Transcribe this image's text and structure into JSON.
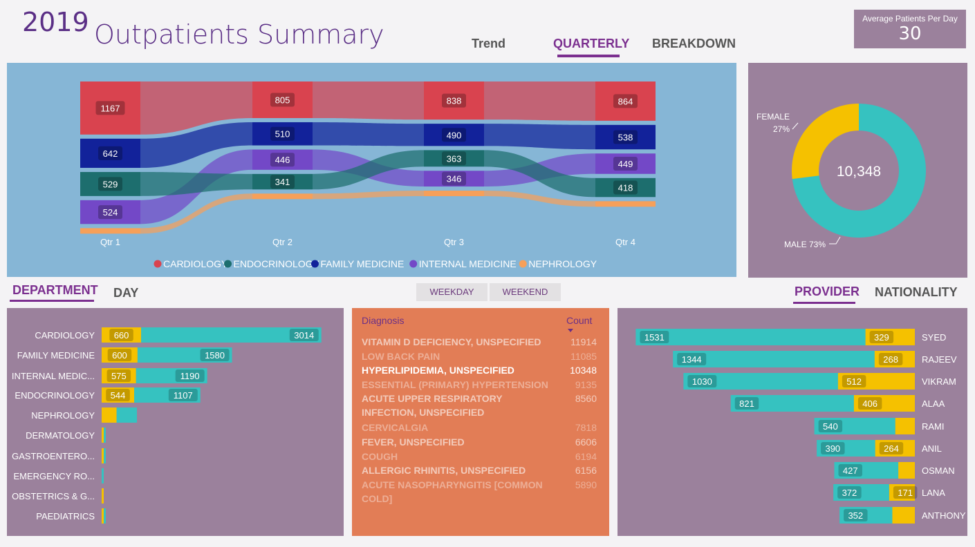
{
  "header": {
    "year": "2019",
    "title": "Outpatients Summary",
    "tabs": [
      {
        "label": "Trend",
        "active": false
      },
      {
        "label": "QUARTERLY",
        "active": true
      },
      {
        "label": "BREAKDOWN",
        "active": false
      }
    ]
  },
  "kpi": {
    "label": "Average Patients Per Day",
    "value": "30"
  },
  "chart_data": [
    {
      "type": "ribbon",
      "categories": [
        "Qtr 1",
        "Qtr 2",
        "Qtr 3",
        "Qtr 4"
      ],
      "series": [
        {
          "name": "CARDIOLOGY",
          "color": "#d9434f",
          "values": [
            1167,
            805,
            838,
            864
          ]
        },
        {
          "name": "ENDOCRINOLOGY",
          "color": "#1d6e6e",
          "values": [
            529,
            341,
            363,
            418
          ]
        },
        {
          "name": "FAMILY MEDICINE",
          "color": "#12229a",
          "values": [
            642,
            510,
            490,
            538
          ]
        },
        {
          "name": "INTERNAL MEDICINE",
          "color": "#7348c7",
          "values": [
            524,
            446,
            346,
            449
          ]
        },
        {
          "name": "NEPHROLOGY",
          "color": "#f6a05a",
          "values": [
            null,
            null,
            null,
            null
          ]
        }
      ],
      "legend_position": "bottom"
    },
    {
      "type": "pie",
      "center_label": "10,348",
      "slices": [
        {
          "label": "FEMALE",
          "pct_label": "27%",
          "value": 27,
          "color": "#f5c100"
        },
        {
          "label": "MALE",
          "pct_label": "73%",
          "value": 73,
          "color": "#36c2c0"
        }
      ]
    },
    {
      "type": "bar",
      "orientation": "horizontal",
      "categories": [
        "CARDIOLOGY",
        "FAMILY MEDICINE",
        "INTERNAL MEDIC...",
        "ENDOCRINOLOGY",
        "NEPHROLOGY",
        "DERMATOLOGY",
        "GASTROENTERO...",
        "EMERGENCY RO...",
        "OBSTETRICS & G...",
        "PAEDIATRICS"
      ],
      "series": [
        {
          "color": "#f5c100",
          "values": [
            660,
            600,
            575,
            544,
            250,
            35,
            8,
            0,
            30,
            5
          ],
          "labels": [
            "660",
            "600",
            "575",
            "544",
            "",
            "",
            "",
            "",
            "",
            ""
          ]
        },
        {
          "color": "#36c2c0",
          "values": [
            3014,
            1580,
            1190,
            1107,
            340,
            15,
            25,
            20,
            0,
            5
          ],
          "labels": [
            "3014",
            "1580",
            "1190",
            "1107",
            "",
            "",
            "",
            "",
            "",
            ""
          ]
        }
      ],
      "xlim": [
        0,
        3700
      ]
    },
    {
      "type": "bar",
      "orientation": "horizontal",
      "categories": [
        "SYED",
        "RAJEEV",
        "VIKRAM",
        "ALAA",
        "RAMI",
        "ANIL",
        "OSMAN",
        "LANA",
        "ANTHONY"
      ],
      "series": [
        {
          "color": "#36c2c0",
          "values": [
            1531,
            1344,
            1030,
            821,
            540,
            390,
            427,
            372,
            352
          ],
          "labels": [
            "1531",
            "1344",
            "1030",
            "821",
            "540",
            "390",
            "427",
            "372",
            "352"
          ]
        },
        {
          "color": "#f5c100",
          "values": [
            329,
            268,
            512,
            406,
            130,
            264,
            110,
            171,
            150
          ],
          "labels": [
            "329",
            "268",
            "512",
            "406",
            "",
            "264",
            "",
            "171",
            ""
          ]
        }
      ],
      "xlim": [
        0,
        2000
      ]
    }
  ],
  "ribbon_legend": [
    {
      "label": "CARDIOLOGY",
      "color": "#d9434f"
    },
    {
      "label": "ENDOCRINOLOGY",
      "color": "#1d6e6e"
    },
    {
      "label": "FAMILY MEDICINE",
      "color": "#12229a"
    },
    {
      "label": "INTERNAL MEDICINE",
      "color": "#7348c7"
    },
    {
      "label": "NEPHROLOGY",
      "color": "#f6a05a"
    }
  ],
  "dept_tabs": [
    {
      "label": "DEPARTMENT",
      "active": true
    },
    {
      "label": "DAY",
      "active": false
    }
  ],
  "day_buttons": [
    "WEEKDAY",
    "WEEKEND"
  ],
  "diagnosis": {
    "col_name": "Diagnosis",
    "col_count": "Count",
    "rows": [
      {
        "name": "VITAMIN D DEFICIENCY, UNSPECIFIED",
        "count": "11914",
        "style": "mid"
      },
      {
        "name": "LOW BACK PAIN",
        "count": "11085",
        "style": "dim"
      },
      {
        "name": "HYPERLIPIDEMIA, UNSPECIFIED",
        "count": "10348",
        "style": "hl"
      },
      {
        "name": "ESSENTIAL (PRIMARY) HYPERTENSION",
        "count": "9135",
        "style": "dim"
      },
      {
        "name": "ACUTE UPPER RESPIRATORY INFECTION, UNSPECIFIED",
        "count": "8560",
        "style": "mid"
      },
      {
        "name": "CERVICALGIA",
        "count": "7818",
        "style": "dim"
      },
      {
        "name": "FEVER, UNSPECIFIED",
        "count": "6606",
        "style": "mid"
      },
      {
        "name": "COUGH",
        "count": "6194",
        "style": "dim"
      },
      {
        "name": "ALLERGIC RHINITIS, UNSPECIFIED",
        "count": "6156",
        "style": "mid"
      },
      {
        "name": "ACUTE NASOPHARYNGITIS [COMMON COLD]",
        "count": "5890",
        "style": "dim"
      }
    ]
  },
  "provider_tabs": [
    {
      "label": "PROVIDER",
      "active": true
    },
    {
      "label": "NATIONALITY",
      "active": false
    }
  ]
}
